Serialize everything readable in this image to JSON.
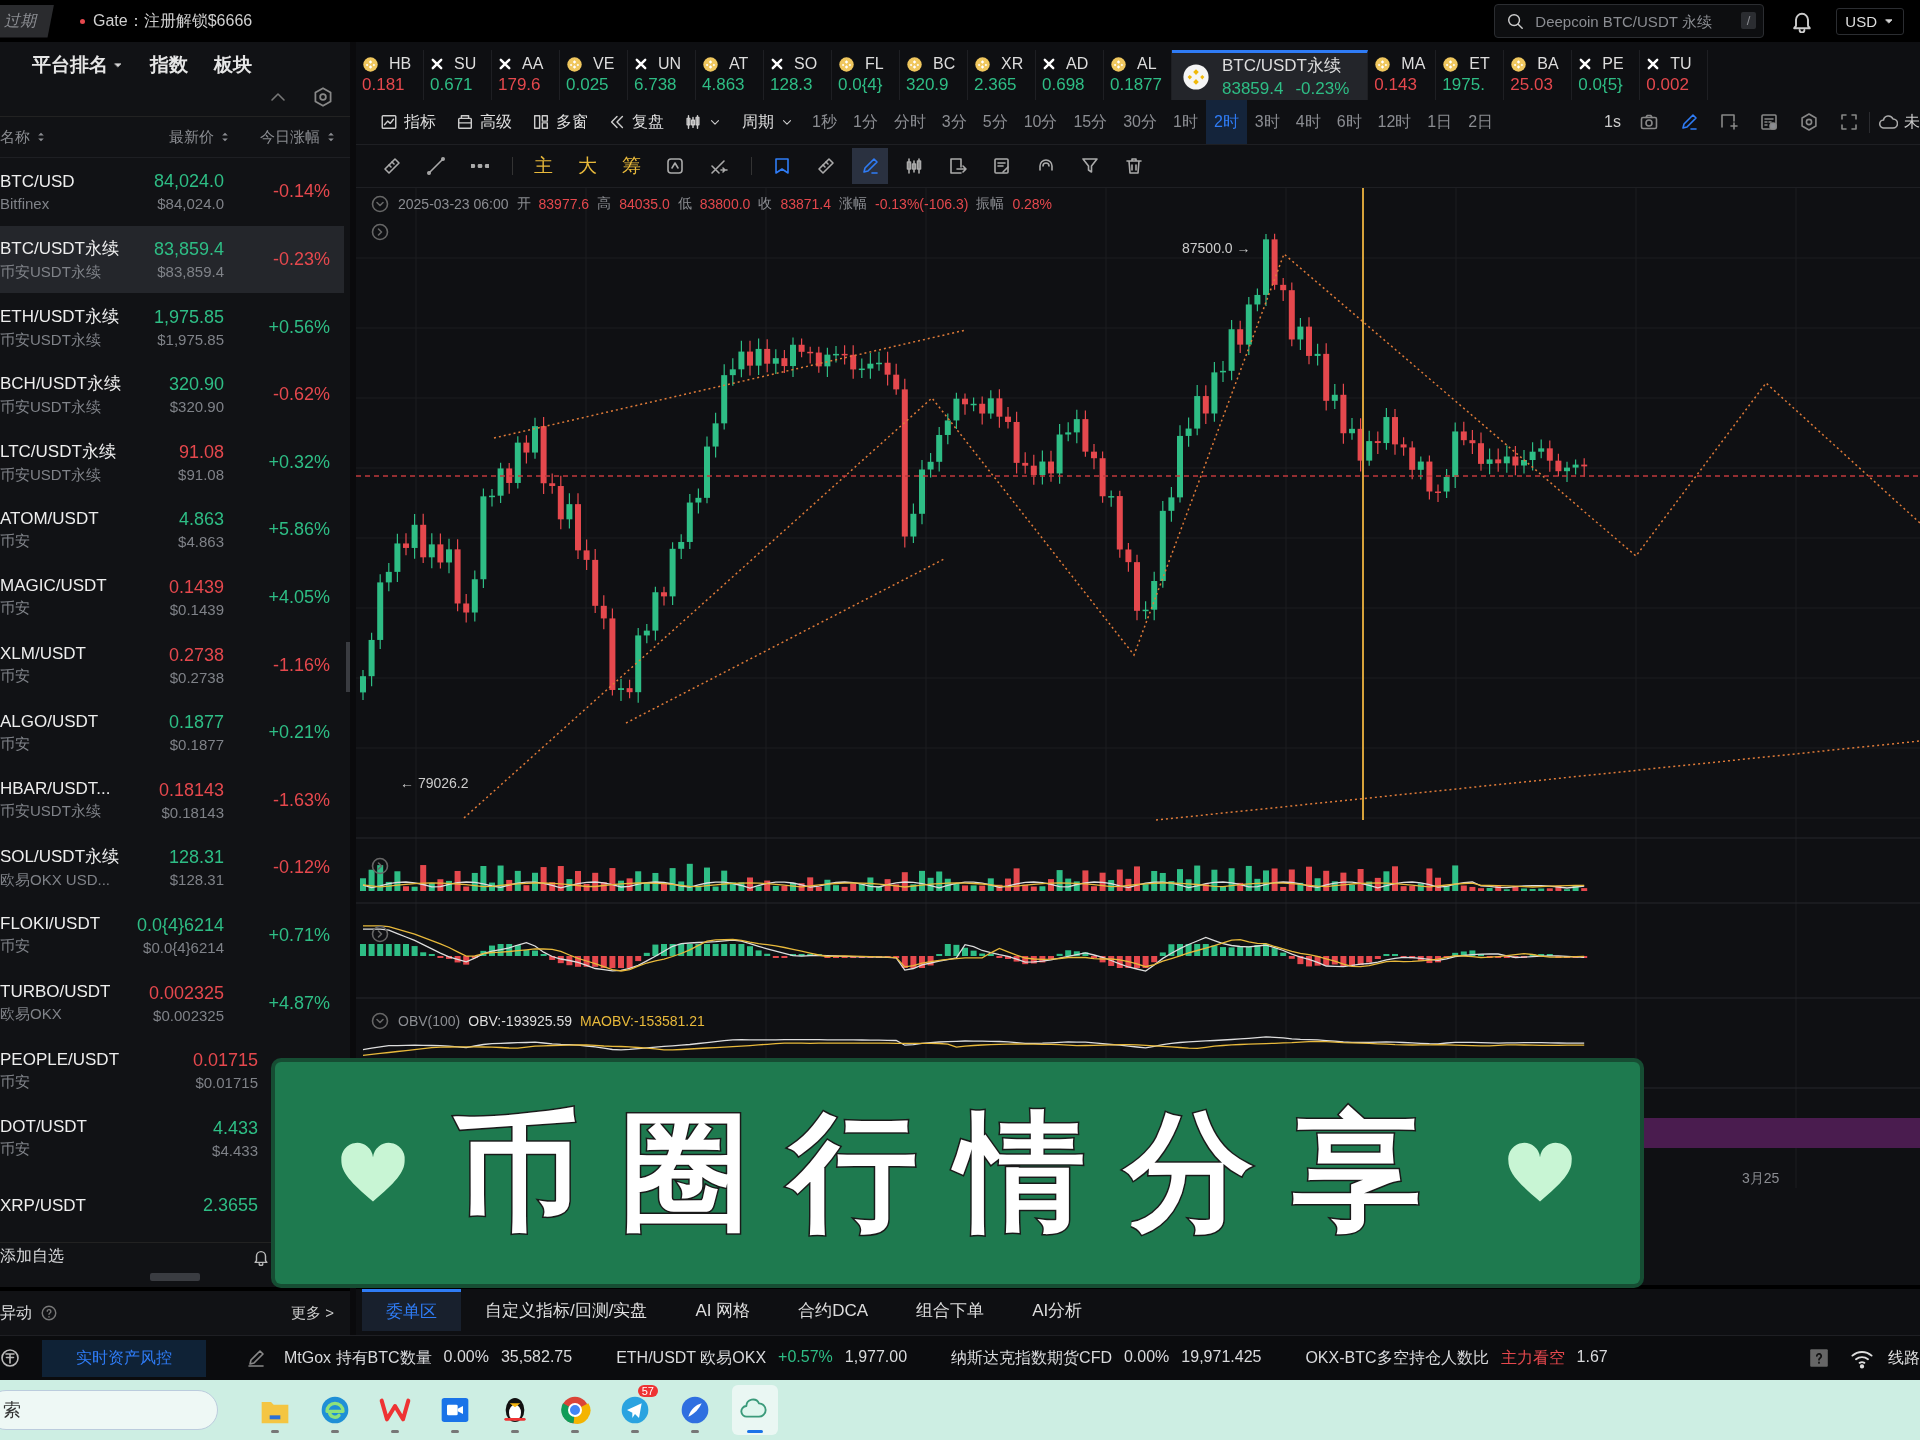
{
  "top_bar": {
    "expired_badge": "过期",
    "promo": "Gate：注册解锁$6666",
    "search": {
      "placeholder": "Deepcoin BTC/USDT 永续",
      "shortcut": "/"
    },
    "currency": "USD"
  },
  "market_panel": {
    "tabs": [
      {
        "label": "平台排名",
        "dropdown": true,
        "selected": false
      },
      {
        "label": "指数",
        "dropdown": false,
        "selected": false
      },
      {
        "label": "板块",
        "dropdown": false,
        "selected": false
      }
    ],
    "columns": [
      "名称",
      "最新价",
      "今日涨幅"
    ],
    "rows": [
      {
        "name": "BTC/USD",
        "exchange": "Bitfinex",
        "price": "84,024.0",
        "price_up": true,
        "price_usd": "$84,024.0",
        "change": "-0.14%",
        "change_up": false,
        "selected": false
      },
      {
        "name": "BTC/USDT永续",
        "exchange": "币安USDT永续",
        "price": "83,859.4",
        "price_up": true,
        "price_usd": "$83,859.4",
        "change": "-0.23%",
        "change_up": false,
        "selected": true
      },
      {
        "name": "ETH/USDT永续",
        "exchange": "币安USDT永续",
        "price": "1,975.85",
        "price_up": true,
        "price_usd": "$1,975.85",
        "change": "+0.56%",
        "change_up": true,
        "selected": false
      },
      {
        "name": "BCH/USDT永续",
        "exchange": "币安USDT永续",
        "price": "320.90",
        "price_up": true,
        "price_usd": "$320.90",
        "change": "-0.62%",
        "change_up": false,
        "selected": false
      },
      {
        "name": "LTC/USDT永续",
        "exchange": "币安USDT永续",
        "price": "91.08",
        "price_up": false,
        "price_usd": "$91.08",
        "change": "+0.32%",
        "change_up": true,
        "selected": false
      },
      {
        "name": "ATOM/USDT",
        "exchange": "币安",
        "price": "4.863",
        "price_up": true,
        "price_usd": "$4.863",
        "change": "+5.86%",
        "change_up": true,
        "selected": false
      },
      {
        "name": "MAGIC/USDT",
        "exchange": "币安",
        "price": "0.1439",
        "price_up": false,
        "price_usd": "$0.1439",
        "change": "+4.05%",
        "change_up": true,
        "selected": false
      },
      {
        "name": "XLM/USDT",
        "exchange": "币安",
        "price": "0.2738",
        "price_up": false,
        "price_usd": "$0.2738",
        "change": "-1.16%",
        "change_up": false,
        "selected": false
      },
      {
        "name": "ALGO/USDT",
        "exchange": "币安",
        "price": "0.1877",
        "price_up": true,
        "price_usd": "$0.1877",
        "change": "+0.21%",
        "change_up": true,
        "selected": false
      },
      {
        "name": "HBAR/USDT...",
        "exchange": "币安USDT永续",
        "price": "0.18143",
        "price_up": false,
        "price_usd": "$0.18143",
        "change": "-1.63%",
        "change_up": false,
        "selected": false
      },
      {
        "name": "SOL/USDT永续",
        "exchange": "欧易OKX USD...",
        "price": "128.31",
        "price_up": true,
        "price_usd": "$128.31",
        "change": "-0.12%",
        "change_up": false,
        "selected": false
      },
      {
        "name": "FLOKI/USDT",
        "exchange": "币安",
        "price": "0.0{4}6214",
        "price_up": true,
        "price_usd": "$0.0{4}6214",
        "change": "+0.71%",
        "change_up": true,
        "selected": false
      },
      {
        "name": "TURBO/USDT",
        "exchange": "欧易OKX",
        "price": "0.002325",
        "price_up": false,
        "price_usd": "$0.002325",
        "change": "+4.87%",
        "change_up": true,
        "selected": false
      },
      {
        "name": "PEOPLE/USDT",
        "exchange": "币安",
        "price": "0.01715",
        "price_up": false,
        "price_usd": "$0.01715",
        "selected": false
      },
      {
        "name": "DOT/USDT",
        "exchange": "币安",
        "price": "4.433",
        "price_up": true,
        "price_usd": "$4.433",
        "selected": false
      },
      {
        "name": "XRP/USDT",
        "price": "2.3655",
        "price_up": true,
        "selected": false
      }
    ],
    "add_watchlist": "添加自选",
    "anomaly": {
      "title": "异动",
      "more": "更多 >"
    }
  },
  "ticker_strip": [
    {
      "symbol": "HB",
      "price": "0.181",
      "up": false,
      "kind": "coin",
      "selected": false
    },
    {
      "symbol": "SU",
      "price": "0.671",
      "up": true,
      "kind": "cross",
      "selected": false
    },
    {
      "symbol": "AA",
      "price": "179.6",
      "up": false,
      "kind": "cross",
      "selected": false
    },
    {
      "symbol": "VE",
      "price": "0.025",
      "up": true,
      "kind": "coin",
      "selected": false
    },
    {
      "symbol": "UN",
      "price": "6.738",
      "up": true,
      "kind": "cross",
      "selected": false
    },
    {
      "symbol": "AT",
      "price": "4.863",
      "up": true,
      "kind": "coin",
      "selected": false
    },
    {
      "symbol": "SO",
      "price": "128.3",
      "up": true,
      "kind": "cross",
      "selected": false
    },
    {
      "symbol": "FL",
      "price": "0.0{4}",
      "up": true,
      "kind": "coin",
      "selected": false
    },
    {
      "symbol": "BC",
      "price": "320.9",
      "up": true,
      "kind": "coin",
      "selected": false
    },
    {
      "symbol": "XR",
      "price": "2.365",
      "up": true,
      "kind": "coin",
      "selected": false
    },
    {
      "symbol": "AD",
      "price": "0.698",
      "up": true,
      "kind": "cross",
      "selected": false
    },
    {
      "symbol": "AL",
      "price": "0.1877",
      "up": true,
      "kind": "coin",
      "selected": false
    },
    {
      "symbol": "BTC/USDT永续",
      "price": "83859.4",
      "change": "-0.23%",
      "up": true,
      "kind": "coin",
      "selected": true
    },
    {
      "symbol": "MA",
      "price": "0.143",
      "up": false,
      "kind": "coin",
      "selected": false
    },
    {
      "symbol": "ET",
      "price": "1975.",
      "up": true,
      "kind": "coin",
      "selected": false
    },
    {
      "symbol": "BA",
      "price": "25.03",
      "up": false,
      "kind": "coin",
      "selected": false
    },
    {
      "symbol": "PE",
      "price": "0.0{5}",
      "up": true,
      "kind": "cross",
      "selected": false
    },
    {
      "symbol": "TU",
      "price": "0.002",
      "up": false,
      "kind": "cross",
      "selected": false
    }
  ],
  "chart_toolbar": {
    "buttons": [
      {
        "kind": "indicator",
        "label": "指标"
      },
      {
        "kind": "advanced",
        "label": "高级"
      },
      {
        "kind": "multi-window",
        "label": "多窗"
      },
      {
        "kind": "replay",
        "label": "复盘"
      }
    ],
    "period_menu": "周期",
    "periods": [
      {
        "label": "1秒",
        "selected": false
      },
      {
        "label": "1分",
        "selected": false
      },
      {
        "label": "分时",
        "selected": false
      },
      {
        "label": "3分",
        "selected": false
      },
      {
        "label": "5分",
        "selected": false
      },
      {
        "label": "10分",
        "selected": false
      },
      {
        "label": "15分",
        "selected": false
      },
      {
        "label": "30分",
        "selected": false
      },
      {
        "label": "1时",
        "selected": false
      },
      {
        "label": "2时",
        "selected": true
      },
      {
        "label": "3时",
        "selected": false
      },
      {
        "label": "4时",
        "selected": false
      },
      {
        "label": "6时",
        "selected": false
      },
      {
        "label": "12时",
        "selected": false
      },
      {
        "label": "1日",
        "selected": false
      },
      {
        "label": "2日",
        "selected": false
      }
    ],
    "speed": "1s",
    "sync_label": "未"
  },
  "drawing_tools": [
    {
      "kind": "ruler",
      "selected": false
    },
    {
      "kind": "line",
      "selected": false
    },
    {
      "kind": "more",
      "selected": false
    },
    {
      "kind": "text",
      "label": "主",
      "selected": false
    },
    {
      "kind": "text",
      "label": "大",
      "selected": false
    },
    {
      "kind": "text",
      "label": "筹",
      "selected": false
    },
    {
      "kind": "cycle",
      "selected": false
    },
    {
      "kind": "cross",
      "selected": false
    },
    {
      "kind": "frame",
      "selected": false
    },
    {
      "kind": "ruler",
      "selected": false
    },
    {
      "kind": "pen",
      "selected": true
    },
    {
      "kind": "candles",
      "selected": false
    },
    {
      "kind": "export",
      "selected": false
    },
    {
      "kind": "note",
      "selected": false
    },
    {
      "kind": "magnet",
      "selected": false
    },
    {
      "kind": "filter",
      "selected": false
    },
    {
      "kind": "trash",
      "selected": false
    }
  ],
  "chart": {
    "timestamp": "2025-03-23 06:00",
    "rising": false,
    "fields": [
      {
        "label": "开",
        "value": "83977.6"
      },
      {
        "label": "高",
        "value": "84035.0"
      },
      {
        "label": "低",
        "value": "83800.0"
      },
      {
        "label": "收",
        "value": "83871.4"
      },
      {
        "label": "涨幅",
        "value": "-0.13%(-106.3)"
      },
      {
        "label": "振幅",
        "value": "0.28%"
      }
    ],
    "high_marker": "87500.0 →",
    "low_marker": "← 79026.2",
    "obv": {
      "name": "OBV(100)",
      "obv": "OBV:-193925.59",
      "maobv": "MAOBV:-153581.21"
    },
    "x_axis_label": "3月25"
  },
  "bottom_tabs": [
    {
      "label": "委单区",
      "selected": true
    },
    {
      "label": "自定义指标/回测/实盘",
      "selected": false
    },
    {
      "label": "AI 网格",
      "selected": false
    },
    {
      "label": "合约DCA",
      "selected": false
    },
    {
      "label": "组合下单",
      "selected": false
    },
    {
      "label": "AI分析",
      "selected": false
    }
  ],
  "status_bar": {
    "risk_button": "实时资产风控",
    "tickers": [
      {
        "name": "MtGox 持有BTC数量",
        "change": "0.00%",
        "color": "#d9dadc",
        "value": "35,582.75"
      },
      {
        "name": "ETH/USDT 欧易OKX",
        "change": "+0.57%",
        "color": "#2ebd85",
        "value": "1,977.00"
      },
      {
        "name": "纳斯达克指数期货CFD",
        "change": "0.00%",
        "color": "#d9dadc",
        "value": "19,971.425"
      },
      {
        "name": "OKX-BTC多空持仓人数比",
        "change": "主力看空",
        "color": "#e5484d",
        "value": "1.67"
      }
    ],
    "route": "线路"
  },
  "taskbar": {
    "search_placeholder": "索",
    "apps": [
      {
        "kind": "folder",
        "selected": false
      },
      {
        "kind": "browser",
        "selected": false
      },
      {
        "kind": "office",
        "selected": false
      },
      {
        "kind": "meeting",
        "selected": false
      },
      {
        "kind": "penguin",
        "selected": false
      },
      {
        "kind": "globe",
        "selected": false
      },
      {
        "kind": "plane",
        "badge": "57",
        "selected": false
      },
      {
        "kind": "feather",
        "selected": false
      },
      {
        "kind": "cloud",
        "selected": true
      }
    ]
  },
  "banner": {
    "text": "币圈行情分享"
  }
}
